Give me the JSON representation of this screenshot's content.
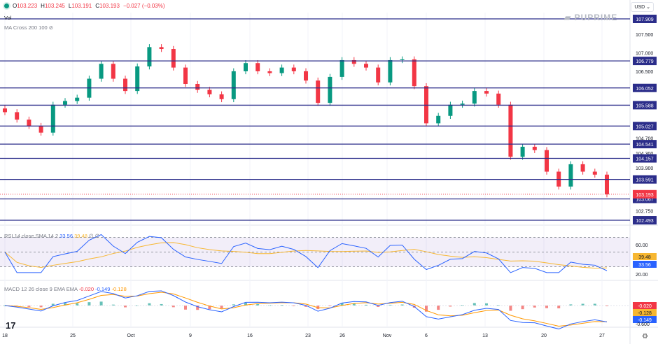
{
  "header": {
    "open_label": "O",
    "open": "103.223",
    "high_label": "H",
    "high": "103.245",
    "low_label": "L",
    "low": "103.191",
    "close_label": "C",
    "close": "103.193",
    "change": "−0.027 (−0.03%)",
    "vol_label": "Vol",
    "ma_label": "MA Cross 200 100"
  },
  "currency": "USD",
  "logo_text": "PUPRIME",
  "tv_logo": "17",
  "colors": {
    "up": "#089981",
    "down": "#f23645",
    "level": "#2b2d8a",
    "rsi": "#2962ff",
    "rsi_ma": "#f7b731",
    "macd": "#2962ff",
    "signal": "#ff9800"
  },
  "chart_data": [
    {
      "type": "candlestick",
      "title": "",
      "price_axis": {
        "ticks": [
          "107.500",
          "107.000",
          "106.500",
          "104.700",
          "104.300",
          "103.900",
          "102.750"
        ],
        "range": [
          102.4,
          108.1
        ]
      },
      "x_ticks": [
        "18",
        "25",
        "Oct",
        "9",
        "16",
        "23",
        "26",
        "Nov",
        "6",
        "13",
        "20",
        "27"
      ],
      "levels": [
        "107.909",
        "106.779",
        "106.052",
        "105.588",
        "105.027",
        "104.541",
        "104.157",
        "103.591",
        "103.067",
        "102.493"
      ],
      "last_price": "103.193",
      "closes": [
        105.4,
        105.2,
        105.03,
        104.85,
        105.6,
        105.7,
        105.79,
        106.3,
        106.7,
        106.3,
        105.97,
        106.63,
        107.15,
        107.1,
        106.6,
        106.16,
        106.0,
        105.88,
        105.75,
        106.5,
        106.72,
        106.5,
        106.45,
        106.6,
        106.5,
        106.25,
        105.65,
        106.35,
        106.8,
        106.7,
        106.6,
        106.2,
        106.8,
        106.82,
        106.1,
        105.1,
        105.3,
        105.6,
        105.63,
        105.97,
        105.9,
        105.6,
        104.2,
        104.47,
        104.38,
        103.8,
        103.4,
        104.0,
        103.8,
        103.72,
        103.19
      ],
      "dates_start": "Sep 18",
      "dates_end": "Nov 27"
    },
    {
      "type": "line",
      "title": "RSI 14 close SMA 14 2",
      "rsi": "33.56",
      "rsi_ma": "39.48",
      "extra": "∅ ∅",
      "ticks": [
        "60.00",
        "20.00"
      ],
      "range": [
        20,
        80
      ]
    },
    {
      "type": "bar",
      "title": "MACD 12 26 close 9 EMA EMA",
      "hist": "-0.020",
      "macd": "-0.149",
      "signal": "-0.128",
      "tick": "-0.600"
    }
  ]
}
